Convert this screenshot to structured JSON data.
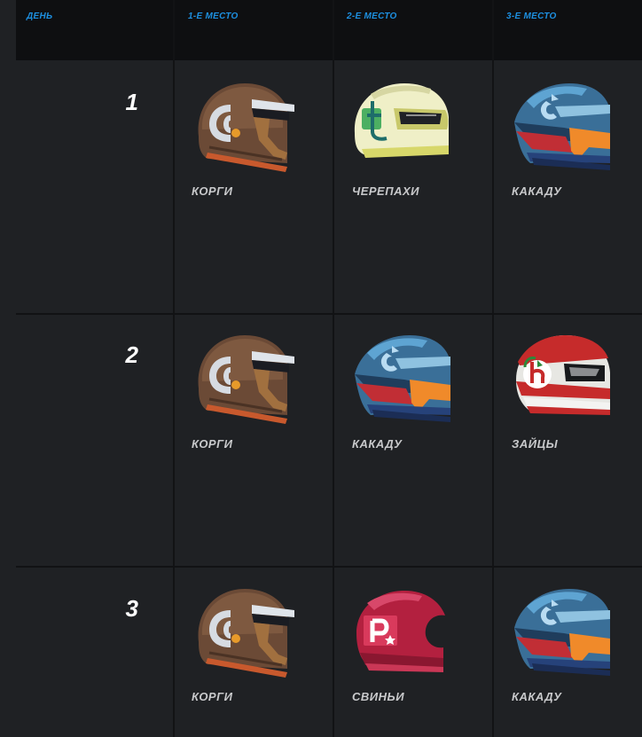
{
  "header": {
    "day": "ДЕНЬ",
    "first": "1-Е МЕСТО",
    "second": "2-Е МЕСТО",
    "third": "3-Е МЕСТО"
  },
  "rows": [
    {
      "day": "1",
      "first": "КОРГИ",
      "second": "ЧЕРЕПАХИ",
      "third": "КАКАДУ"
    },
    {
      "day": "2",
      "first": "КОРГИ",
      "second": "КАКАДУ",
      "third": "ЗАЙЦЫ"
    },
    {
      "day": "3",
      "first": "КОРГИ",
      "second": "СВИНЬИ",
      "third": "КАКАДУ"
    }
  ],
  "icons": {
    "korgi": "corgi-helmet-icon",
    "cherepahi": "turtle-helmet-icon",
    "kakadu": "cockatoo-helmet-icon",
    "zaicy": "hare-helmet-icon",
    "svini": "pig-helmet-icon"
  },
  "colors": {
    "header_text": "#1d8fe0",
    "background": "#1f2124",
    "header_bg": "#0e0f11"
  }
}
